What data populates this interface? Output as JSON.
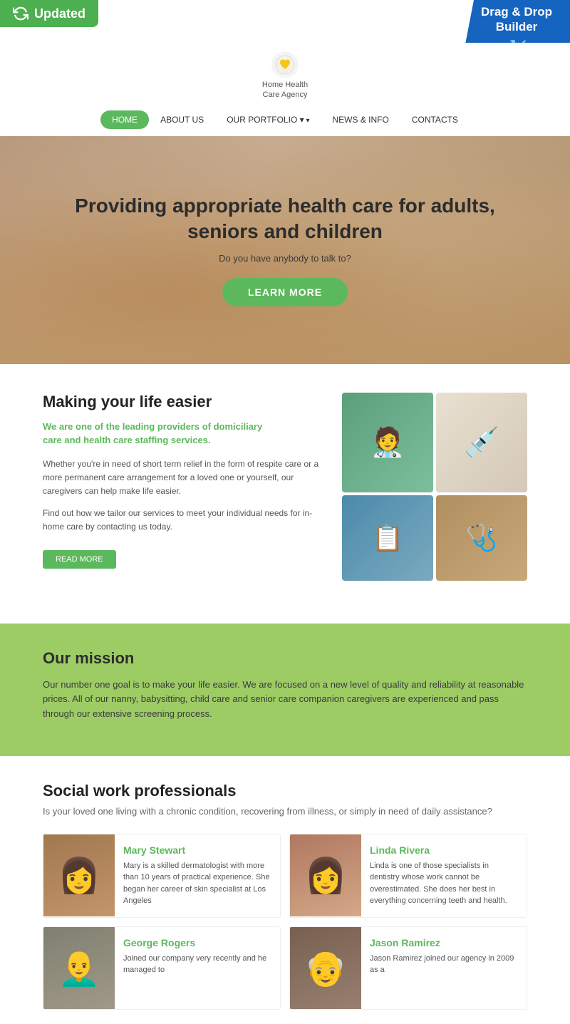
{
  "badges": {
    "updated_label": "Updated",
    "dnd_label": "Drag & Drop\nBuilder",
    "dnd_arrows": "↗↙"
  },
  "header": {
    "logo_text": "Home Health\nCare Agency",
    "logo_icon": "❤"
  },
  "nav": {
    "items": [
      {
        "label": "HOME",
        "active": true
      },
      {
        "label": "ABOUT US",
        "active": false
      },
      {
        "label": "OUR PORTFOLIO",
        "active": false,
        "dropdown": true
      },
      {
        "label": "NEWS & INFO",
        "active": false
      },
      {
        "label": "CONTACTS",
        "active": false
      }
    ]
  },
  "hero": {
    "title": "Providing appropriate health care for adults, seniors and children",
    "subtitle": "Do you have anybody to talk to?",
    "cta_label": "LEARN MORE"
  },
  "section_life": {
    "title": "Making your life easier",
    "highlight": "We are one of the leading providers of domiciliary\ncare and health care staffing services.",
    "body1": "Whether you're in need of short term relief in the form of respite care or a more permanent care arrangement for a loved one or yourself, our caregivers can help make life easier.",
    "body2": "Find out how we tailor our services to meet your individual needs for in-home care by contacting us today.",
    "read_more": "READ MORE"
  },
  "section_mission": {
    "title": "Our mission",
    "body": "Our number one goal is to make your life easier. We are focused on a new level of quality and reliability at reasonable prices. All of our nanny, babysitting, child care and senior care companion caregivers are experienced and pass through our extensive screening process."
  },
  "section_professionals": {
    "title": "Social work professionals",
    "subtitle": "Is your loved one living with a chronic condition, recovering from illness, or simply in need of daily assistance?",
    "team": [
      {
        "name": "Mary Stewart",
        "desc": "Mary is a skilled dermatologist with more than 10 years of practical experience. She began her career of skin specialist at Los Angeles",
        "photo_emoji": "👩"
      },
      {
        "name": "Linda Rivera",
        "desc": "Linda is one of those specialists in dentistry whose work cannot be overestimated. She does her best in everything concerning teeth and health.",
        "photo_emoji": "👩"
      },
      {
        "name": "George Rogers",
        "desc": "Joined our company very recently and he managed to",
        "photo_emoji": "👨"
      },
      {
        "name": "Jason Ramirez",
        "desc": "Jason Ramirez joined our agency in 2009 as a",
        "photo_emoji": "👴"
      }
    ]
  }
}
